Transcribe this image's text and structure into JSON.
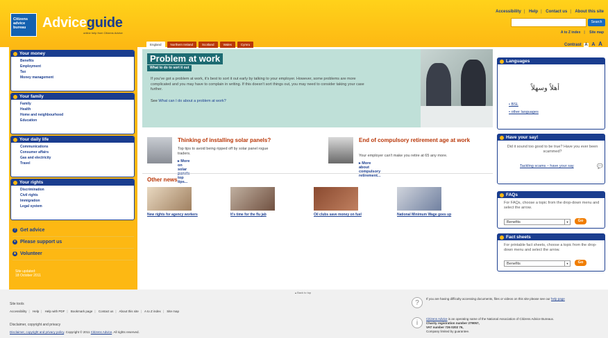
{
  "header": {
    "logo_text": "Citizens advice bureau",
    "brand_light": "Advice",
    "brand_bold": "guide",
    "tagline": "online help from Citizens Advice",
    "top_links": [
      "Accessibility",
      "Help",
      "Contact us",
      "About this site"
    ],
    "search_button": "Search",
    "sub_links": [
      "A to Z index",
      "Site map"
    ],
    "contrast_label": "Contrast",
    "contrast_options": [
      "A",
      "A",
      "A"
    ]
  },
  "tabs": [
    "England",
    "Northern Ireland",
    "Scotland",
    "Wales",
    "Cymru"
  ],
  "nav": [
    {
      "title": "Your money",
      "items": [
        "Benefits",
        "Employment",
        "Tax",
        "Money management"
      ]
    },
    {
      "title": "Your family",
      "items": [
        "Family",
        "Health",
        "Home and neighbourhood",
        "Education"
      ]
    },
    {
      "title": "Your daily life",
      "items": [
        "Communications",
        "Consumer affairs",
        "Gas and electricity",
        "Travel"
      ]
    },
    {
      "title": "Your rights",
      "items": [
        "Discrimination",
        "Civil rights",
        "Immigration",
        "Legal system"
      ]
    }
  ],
  "yellow_links": [
    "Get advice",
    "Please support us",
    "Volunteer"
  ],
  "updated": {
    "label": "Site updated:",
    "date": "18 October 2011"
  },
  "hero": {
    "title": "Problem at work",
    "subtitle": "What to do to sort it out",
    "body": "If you've got a problem at work, it's best to sort it out early by talking to your employer. However, some problems are more complicated and you may have to complain in writing. If this doesn't sort things out, you may need to consider taking your case further.",
    "see_prefix": "See ",
    "see_link": "What can I do about a problem at work?"
  },
  "promos": [
    {
      "title": "Thinking of installing solar panels?",
      "body": "Top tips to avoid being ripped off by solar panel rogue traders.",
      "more": "More on solar panels top tips..."
    },
    {
      "title": "End of compulsory retirement age at work",
      "body": "Your employer can't make you retire at 65 any more.",
      "more": "More about compulsory retirement..."
    }
  ],
  "other_news": {
    "title": "Other news",
    "items": [
      "New rights for agency workers",
      "It's time for the flu jab",
      "Oil clubs save money on fuel",
      "National Minimum Wage goes up"
    ]
  },
  "languages": {
    "title": "Languages",
    "arabic": "أهلاً وسهلاً",
    "links": [
      "BSL",
      "other languages"
    ]
  },
  "say": {
    "title": "Have your say!",
    "text": "Did it sound too good to be true? Have you ever been scammed?",
    "link": "Tackling scams – have your say"
  },
  "faqs": {
    "title": "FAQs",
    "text": "For FAQs, choose a topic from the drop-down menu and select the arrow.",
    "select": "Benefits",
    "go": "Go"
  },
  "facts": {
    "title": "Fact sheets",
    "text": "For printable fact sheets, choose a topic from the drop-down menu and select the arrow.",
    "select": "Benefits",
    "go": "Go"
  },
  "footer": {
    "back_top": "Back to top",
    "site_tools": "Site tools",
    "tools": [
      "Accessibility",
      "Help",
      "Help with PDF",
      "Bookmark page",
      "Contact us",
      "About this site",
      "A to Z index",
      "Site map"
    ],
    "disclaimer_title": "Disclaimer, copyright and privacy",
    "disclaimer_link": "Disclaimer, copyright and privacy policy",
    "copyright_mid": ". Copyright © 2011 ",
    "copyright_link": "Citizens Advice",
    "copyright_end": ". All rights reserved.",
    "help_text": "If you are having difficulty accessing documents, files or videos on this site please see our ",
    "help_link": "help page",
    "ca_link": "Citizens Advice",
    "ca_text": " is an operating name of the National Association of Citizens Advice Bureaux.",
    "charity": "Charity registration number 279057,",
    "vat": "VAT number 726 0202 76,",
    "company": "Company limited by guarantee."
  }
}
